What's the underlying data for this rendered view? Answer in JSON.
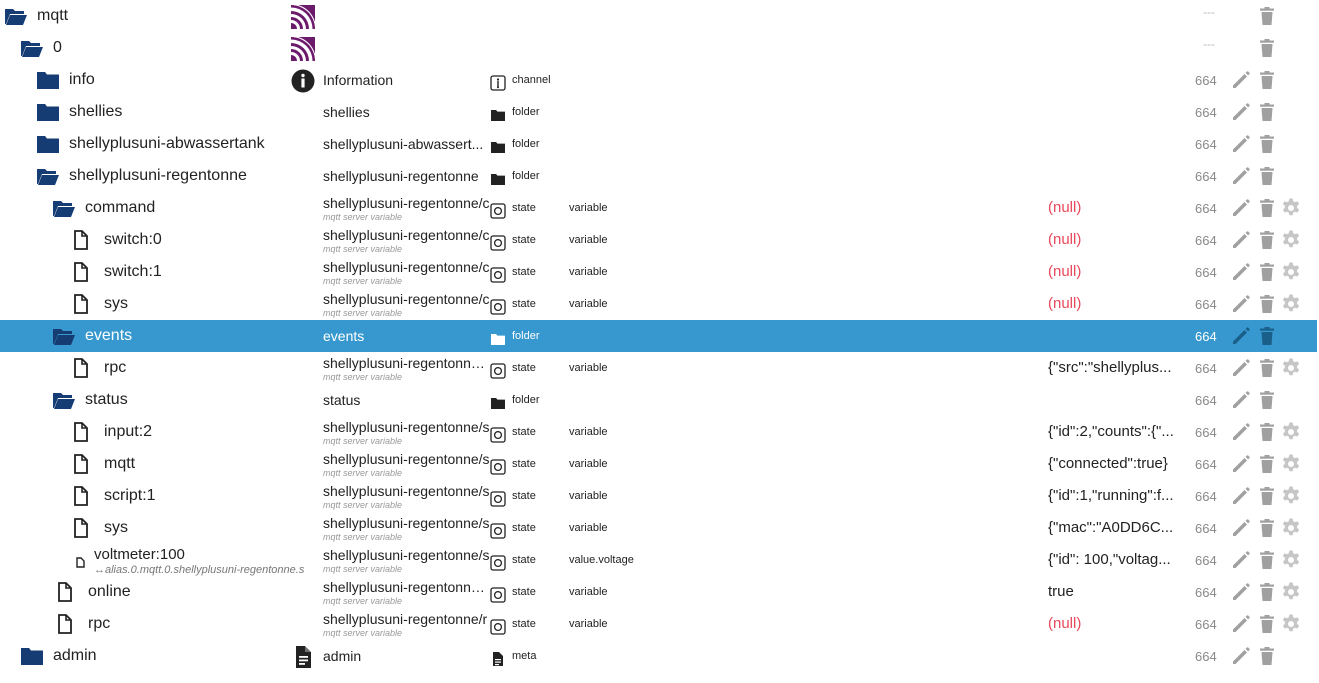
{
  "colors": {
    "folder": "#163c74",
    "selected": "#3798cf",
    "null": "#e9485a",
    "mqtt_logo": "#6c1a6c",
    "action_icon": "#a0a0a0"
  },
  "rows": [
    {
      "name": "mqtt",
      "indent": 0,
      "icon": "folder-open-icon",
      "channelIcon": "mqtt-logo-icon",
      "cname": "",
      "cnameSub": "",
      "typeIcon": "",
      "type": "",
      "role": "",
      "value": "",
      "valueNull": false,
      "acl": "---",
      "actions": [
        "delete"
      ]
    },
    {
      "name": "0",
      "indent": 1,
      "icon": "folder-open-icon",
      "channelIcon": "mqtt-logo-icon",
      "cname": "",
      "cnameSub": "",
      "typeIcon": "",
      "type": "",
      "role": "",
      "value": "",
      "valueNull": false,
      "acl": "---",
      "actions": [
        "delete"
      ]
    },
    {
      "name": "info",
      "indent": 2,
      "icon": "folder-icon",
      "channelIcon": "info-icon",
      "cname": "Information",
      "cnameSub": "",
      "typeIcon": "channel-icon",
      "type": "channel",
      "role": "",
      "value": "",
      "valueNull": false,
      "acl": "664",
      "actions": [
        "edit",
        "delete"
      ]
    },
    {
      "name": "shellies",
      "indent": 2,
      "icon": "folder-icon",
      "channelIcon": "",
      "cname": "shellies",
      "cnameSub": "",
      "typeIcon": "folder-small-icon",
      "type": "folder",
      "role": "",
      "value": "",
      "valueNull": false,
      "acl": "664",
      "actions": [
        "edit",
        "delete"
      ]
    },
    {
      "name": "shellyplusuni-abwassertank",
      "indent": 2,
      "icon": "folder-icon",
      "channelIcon": "",
      "cname": "shellyplusuni-abwassert...",
      "cnameSub": "",
      "typeIcon": "folder-small-icon",
      "type": "folder",
      "role": "",
      "value": "",
      "valueNull": false,
      "acl": "664",
      "actions": [
        "edit",
        "delete"
      ]
    },
    {
      "name": "shellyplusuni-regentonne",
      "indent": 2,
      "icon": "folder-open-icon",
      "channelIcon": "",
      "cname": "shellyplusuni-regentonne",
      "cnameSub": "",
      "typeIcon": "folder-small-icon",
      "type": "folder",
      "role": "",
      "value": "",
      "valueNull": false,
      "acl": "664",
      "actions": [
        "edit",
        "delete"
      ]
    },
    {
      "name": "command",
      "indent": 3,
      "icon": "folder-open-icon",
      "channelIcon": "",
      "cname": "shellyplusuni-regentonne/c",
      "cnameSub": "mqtt server variable",
      "typeIcon": "state-icon",
      "type": "state",
      "role": "variable",
      "value": "(null)",
      "valueNull": true,
      "acl": "664",
      "actions": [
        "edit",
        "delete",
        "settings"
      ]
    },
    {
      "name": "switch:0",
      "indent": 4,
      "icon": "file-icon",
      "channelIcon": "",
      "cname": "shellyplusuni-regentonne/c",
      "cnameSub": "mqtt server variable",
      "typeIcon": "state-icon",
      "type": "state",
      "role": "variable",
      "value": "(null)",
      "valueNull": true,
      "acl": "664",
      "actions": [
        "edit",
        "delete",
        "settings"
      ]
    },
    {
      "name": "switch:1",
      "indent": 4,
      "icon": "file-icon",
      "channelIcon": "",
      "cname": "shellyplusuni-regentonne/c",
      "cnameSub": "mqtt server variable",
      "typeIcon": "state-icon",
      "type": "state",
      "role": "variable",
      "value": "(null)",
      "valueNull": true,
      "acl": "664",
      "actions": [
        "edit",
        "delete",
        "settings"
      ]
    },
    {
      "name": "sys",
      "indent": 4,
      "icon": "file-icon",
      "channelIcon": "",
      "cname": "shellyplusuni-regentonne/c",
      "cnameSub": "mqtt server variable",
      "typeIcon": "state-icon",
      "type": "state",
      "role": "variable",
      "value": "(null)",
      "valueNull": true,
      "acl": "664",
      "actions": [
        "edit",
        "delete",
        "settings"
      ]
    },
    {
      "name": "events",
      "indent": 3,
      "icon": "folder-open-icon",
      "channelIcon": "",
      "cname": "events",
      "cnameSub": "",
      "typeIcon": "folder-small-icon",
      "type": "folder",
      "role": "",
      "value": "",
      "valueNull": false,
      "acl": "664",
      "actions": [
        "edit",
        "delete"
      ],
      "selected": true
    },
    {
      "name": "rpc",
      "indent": 4,
      "icon": "file-icon",
      "channelIcon": "",
      "cname": "shellyplusuni-regentonne/e",
      "cnameSub": "mqtt server variable",
      "typeIcon": "state-icon",
      "type": "state",
      "role": "variable",
      "value": "{\"src\":\"shellyplus...",
      "valueNull": false,
      "acl": "664",
      "actions": [
        "edit",
        "delete",
        "settings"
      ]
    },
    {
      "name": "status",
      "indent": 3,
      "icon": "folder-open-icon",
      "channelIcon": "",
      "cname": "status",
      "cnameSub": "",
      "typeIcon": "folder-small-icon",
      "type": "folder",
      "role": "",
      "value": "",
      "valueNull": false,
      "acl": "664",
      "actions": [
        "edit",
        "delete"
      ]
    },
    {
      "name": "input:2",
      "indent": 4,
      "icon": "file-icon",
      "channelIcon": "",
      "cname": "shellyplusuni-regentonne/s",
      "cnameSub": "mqtt server variable",
      "typeIcon": "state-icon",
      "type": "state",
      "role": "variable",
      "value": "{\"id\":2,\"counts\":{\"...",
      "valueNull": false,
      "acl": "664",
      "actions": [
        "edit",
        "delete",
        "settings"
      ]
    },
    {
      "name": "mqtt",
      "indent": 4,
      "icon": "file-icon",
      "channelIcon": "",
      "cname": "shellyplusuni-regentonne/s",
      "cnameSub": "mqtt server variable",
      "typeIcon": "state-icon",
      "type": "state",
      "role": "variable",
      "value": "{\"connected\":true}",
      "valueNull": false,
      "acl": "664",
      "actions": [
        "edit",
        "delete",
        "settings"
      ]
    },
    {
      "name": "script:1",
      "indent": 4,
      "icon": "file-icon",
      "channelIcon": "",
      "cname": "shellyplusuni-regentonne/s",
      "cnameSub": "mqtt server variable",
      "typeIcon": "state-icon",
      "type": "state",
      "role": "variable",
      "value": "{\"id\":1,\"running\":f...",
      "valueNull": false,
      "acl": "664",
      "actions": [
        "edit",
        "delete",
        "settings"
      ]
    },
    {
      "name": "sys",
      "indent": 4,
      "icon": "file-icon",
      "channelIcon": "",
      "cname": "shellyplusuni-regentonne/s",
      "cnameSub": "mqtt server variable",
      "typeIcon": "state-icon",
      "type": "state",
      "role": "variable",
      "value": "{\"mac\":\"A0DD6C...",
      "valueNull": false,
      "acl": "664",
      "actions": [
        "edit",
        "delete",
        "settings"
      ]
    },
    {
      "name": "voltmeter:100",
      "alias": "↔alias.0.mqtt.0.shellyplusuni-regentonne.s",
      "indent": 4,
      "icon": "file-small-icon",
      "channelIcon": "",
      "cname": "shellyplusuni-regentonne/s",
      "cnameSub": "mqtt server variable",
      "typeIcon": "state-icon",
      "type": "state",
      "role": "value.voltage",
      "value": "{\"id\": 100,\"voltag...",
      "valueNull": false,
      "acl": "664",
      "actions": [
        "edit",
        "delete",
        "settings"
      ]
    },
    {
      "name": "online",
      "indent": 3,
      "icon": "file-icon",
      "channelIcon": "",
      "cname": "shellyplusuni-regentonne/o",
      "cnameSub": "mqtt server variable",
      "typeIcon": "state-icon",
      "type": "state",
      "role": "variable",
      "value": "true",
      "valueNull": false,
      "acl": "664",
      "actions": [
        "edit",
        "delete",
        "settings"
      ]
    },
    {
      "name": "rpc",
      "indent": 3,
      "icon": "file-icon",
      "channelIcon": "",
      "cname": "shellyplusuni-regentonne/r",
      "cnameSub": "mqtt server variable",
      "typeIcon": "state-icon",
      "type": "state",
      "role": "variable",
      "value": "(null)",
      "valueNull": true,
      "acl": "664",
      "actions": [
        "edit",
        "delete",
        "settings"
      ]
    },
    {
      "name": "admin",
      "indent": 1,
      "icon": "folder-icon",
      "channelIcon": "document-icon",
      "cname": "admin",
      "cnameSub": "",
      "typeIcon": "meta-icon",
      "type": "meta",
      "role": "",
      "value": "",
      "valueNull": false,
      "acl": "664",
      "actions": [
        "edit",
        "delete"
      ]
    }
  ]
}
